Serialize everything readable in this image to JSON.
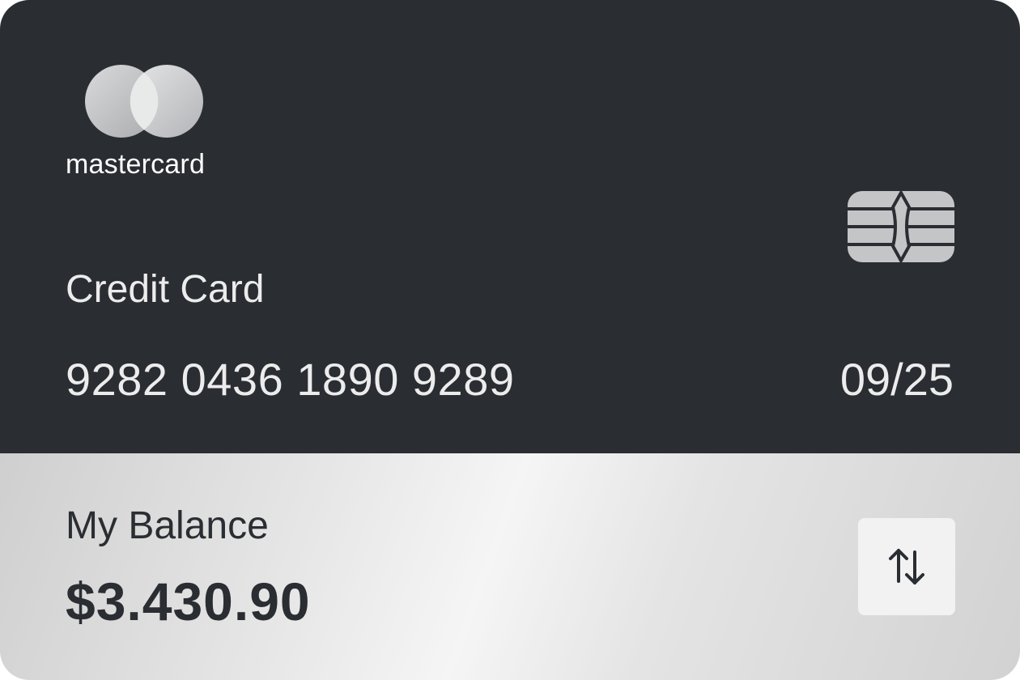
{
  "brand": {
    "name": "mastercard",
    "logo_icon": "mastercard-logo-icon"
  },
  "card": {
    "type_label": "Credit Card",
    "number": "9282 0436 1890 9289",
    "expiry": "09/25",
    "chip_icon": "card-chip-icon"
  },
  "balance": {
    "label": "My Balance",
    "value": "$3.430.90",
    "action_icon": "swap-arrows-icon"
  },
  "colors": {
    "card_dark": "#2a2d32",
    "text_light": "#ececec",
    "silver": "#e6e6e6",
    "chip": "#c4c5c7"
  }
}
